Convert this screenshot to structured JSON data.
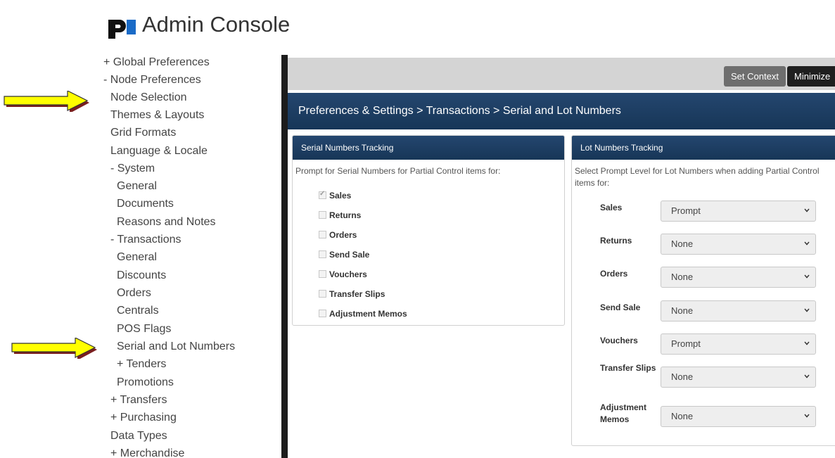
{
  "app": {
    "title": "Admin Console",
    "logo_letter": "p",
    "logo_accent": "#1a6bc7"
  },
  "sidebar": {
    "items": [
      {
        "label": "+ Global Preferences"
      },
      {
        "label": "- Node Preferences"
      },
      {
        "label": "Node Selection"
      },
      {
        "label": "Themes & Layouts"
      },
      {
        "label": "Grid Formats"
      },
      {
        "label": "Language & Locale"
      },
      {
        "label": "- System"
      },
      {
        "label": "General"
      },
      {
        "label": "Documents"
      },
      {
        "label": "Reasons and Notes"
      },
      {
        "label": "- Transactions"
      },
      {
        "label": "General"
      },
      {
        "label": "Discounts"
      },
      {
        "label": "Orders"
      },
      {
        "label": "Centrals"
      },
      {
        "label": "POS Flags"
      },
      {
        "label": "Serial and Lot Numbers"
      },
      {
        "label": "+ Tenders"
      },
      {
        "label": "Promotions"
      },
      {
        "label": "+ Transfers"
      },
      {
        "label": "+ Purchasing"
      },
      {
        "label": "Data Types"
      },
      {
        "label": "+ Merchandise"
      }
    ]
  },
  "toolbar": {
    "set_context": "Set Context",
    "minimize": "Minimize"
  },
  "breadcrumb": "Preferences & Settings > Transactions > Serial and Lot Numbers",
  "serial_panel": {
    "title": "Serial Numbers Tracking",
    "description": "Prompt for Serial Numbers for Partial Control items for:",
    "options": [
      {
        "label": "Sales",
        "checked": true
      },
      {
        "label": "Returns",
        "checked": false
      },
      {
        "label": "Orders",
        "checked": false
      },
      {
        "label": "Send Sale",
        "checked": false
      },
      {
        "label": "Vouchers",
        "checked": false
      },
      {
        "label": "Transfer Slips",
        "checked": false
      },
      {
        "label": "Adjustment Memos",
        "checked": false
      }
    ]
  },
  "lot_panel": {
    "title": "Lot Numbers Tracking",
    "description": "Select Prompt Level for Lot Numbers when adding Partial Control items for:",
    "rows": [
      {
        "label": "Sales",
        "value": "Prompt"
      },
      {
        "label": "Returns",
        "value": "None"
      },
      {
        "label": "Orders",
        "value": "None"
      },
      {
        "label": "Send Sale",
        "value": "None"
      },
      {
        "label": "Vouchers",
        "value": "Prompt"
      },
      {
        "label": "Transfer Slips",
        "value": "None"
      },
      {
        "label": "Adjustment Memos",
        "value": "None"
      }
    ]
  },
  "colors": {
    "header_blue": "#1d3f66",
    "arrow_yellow": "#ffff00",
    "arrow_shadow": "#7a1f1f"
  }
}
